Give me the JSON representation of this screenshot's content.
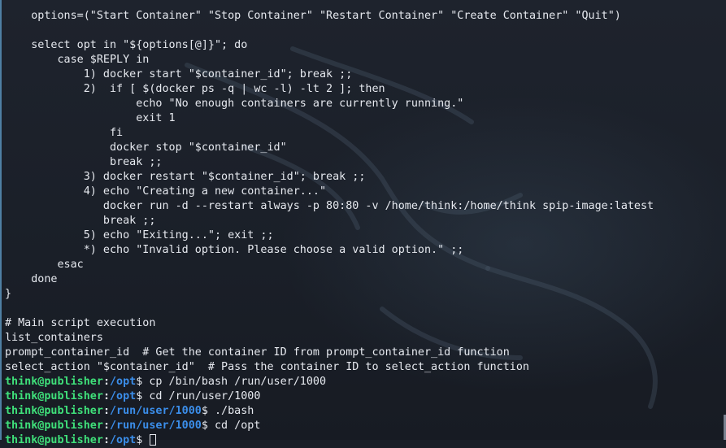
{
  "code_lines": [
    "    options=(\"Start Container\" \"Stop Container\" \"Restart Container\" \"Create Container\" \"Quit\")",
    "",
    "    select opt in \"${options[@]}\"; do",
    "        case $REPLY in",
    "            1) docker start \"$container_id\"; break ;;",
    "            2)  if [ $(docker ps -q | wc -l) -lt 2 ]; then",
    "                    echo \"No enough containers are currently running.\"",
    "                    exit 1",
    "                fi",
    "                docker stop \"$container_id\"",
    "                break ;;",
    "            3) docker restart \"$container_id\"; break ;;",
    "            4) echo \"Creating a new container...\"",
    "               docker run -d --restart always -p 80:80 -v /home/think:/home/think spip-image:latest",
    "               break ;;",
    "            5) echo \"Exiting...\"; exit ;;",
    "            *) echo \"Invalid option. Please choose a valid option.\" ;;",
    "        esac",
    "    done",
    "}",
    "",
    "# Main script execution",
    "list_containers",
    "prompt_container_id  # Get the container ID from prompt_container_id function",
    "select_action \"$container_id\"  # Pass the container ID to select_action function"
  ],
  "prompts": [
    {
      "user": "think@publisher",
      "path": "/opt",
      "command": "cp /bin/bash /run/user/1000"
    },
    {
      "user": "think@publisher",
      "path": "/opt",
      "command": "cd /run/user/1000"
    },
    {
      "user": "think@publisher",
      "path": "/run/user/1000",
      "command": "./bash"
    },
    {
      "user": "think@publisher",
      "path": "/run/user/1000",
      "command": "cd /opt"
    },
    {
      "user": "think@publisher",
      "path": "/opt",
      "command": ""
    }
  ],
  "colors": {
    "background": "#1b2029",
    "text": "#e6e9ef",
    "prompt_user": "#3fe07a",
    "prompt_path": "#3b8eea"
  }
}
